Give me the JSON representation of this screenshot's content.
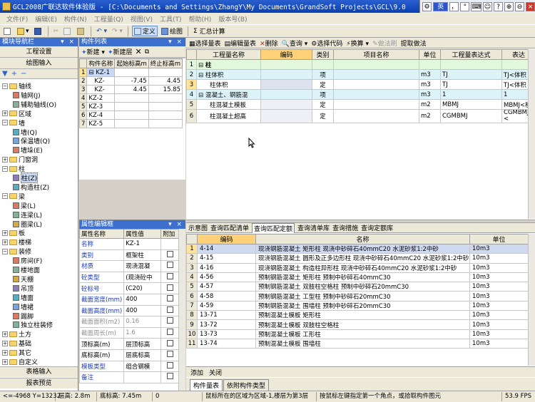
{
  "window": {
    "title": "GCL2008广联达软件体验版 - [C:\\Documents and Settings\\ZhangY\\My Documents\\GrandSoft Projects\\GCL\\9.0",
    "ime": {
      "lang": "英",
      "items": [
        "，",
        "°",
        "⌨",
        "☺",
        "?",
        "⊕",
        "⊖",
        "×"
      ]
    }
  },
  "menubar": [
    "文件(F)",
    "编辑(E)",
    "构件(N)",
    "工程量(Q)",
    "视图(V)",
    "工具(T)",
    "帮助(H)",
    "版本号(B)"
  ],
  "toolbar": {
    "define": "定义",
    "draw": "绘图",
    "sum": "汇总计算"
  },
  "nav": {
    "header": "模块导航栏",
    "project_settings": "工程设置",
    "drawing_input": "绘图输入",
    "tree": [
      {
        "label": "轴线",
        "pm": "⊟",
        "level": 0,
        "type": "folder"
      },
      {
        "label": "轴网(J)",
        "level": 1,
        "type": "item"
      },
      {
        "label": "辅助轴线(O)",
        "level": 1,
        "type": "item"
      },
      {
        "label": "区域",
        "pm": "⊞",
        "level": 0,
        "type": "folder"
      },
      {
        "label": "墙",
        "pm": "⊟",
        "level": 0,
        "type": "folder"
      },
      {
        "label": "墙(Q)",
        "level": 1,
        "type": "item"
      },
      {
        "label": "保温墙(Q)",
        "level": 1,
        "type": "item"
      },
      {
        "label": "墙垛(E)",
        "level": 1,
        "type": "item"
      },
      {
        "label": "门窗洞",
        "pm": "⊞",
        "level": 0,
        "type": "folder"
      },
      {
        "label": "柱",
        "pm": "⊟",
        "level": 0,
        "type": "folder"
      },
      {
        "label": "柱(Z)",
        "level": 1,
        "type": "item",
        "selected": true
      },
      {
        "label": "构造柱(Z)",
        "level": 1,
        "type": "item"
      },
      {
        "label": "梁",
        "pm": "⊟",
        "level": 0,
        "type": "folder"
      },
      {
        "label": "梁(L)",
        "level": 1,
        "type": "item"
      },
      {
        "label": "连梁(L)",
        "level": 1,
        "type": "item"
      },
      {
        "label": "圈梁(L)",
        "level": 1,
        "type": "item"
      },
      {
        "label": "板",
        "pm": "⊞",
        "level": 0,
        "type": "folder"
      },
      {
        "label": "楼梯",
        "pm": "⊞",
        "level": 0,
        "type": "folder"
      },
      {
        "label": "装修",
        "pm": "⊟",
        "level": 0,
        "type": "folder"
      },
      {
        "label": "房间(F)",
        "level": 1,
        "type": "item"
      },
      {
        "label": "楼地面",
        "level": 1,
        "type": "item"
      },
      {
        "label": "天棚",
        "level": 1,
        "type": "item"
      },
      {
        "label": "吊顶",
        "level": 1,
        "type": "item"
      },
      {
        "label": "墙面",
        "level": 1,
        "type": "item"
      },
      {
        "label": "墙裙",
        "level": 1,
        "type": "item"
      },
      {
        "label": "踢脚",
        "level": 1,
        "type": "item"
      },
      {
        "label": "独立柱装修",
        "level": 1,
        "type": "item"
      },
      {
        "label": "土方",
        "pm": "⊞",
        "level": 0,
        "type": "folder"
      },
      {
        "label": "基础",
        "pm": "⊞",
        "level": 0,
        "type": "folder"
      },
      {
        "label": "其它",
        "pm": "⊞",
        "level": 0,
        "type": "folder"
      },
      {
        "label": "自定义",
        "pm": "⊞",
        "level": 0,
        "type": "folder"
      }
    ],
    "table_input": "表格输入",
    "report_preview": "报表预览"
  },
  "component_list": {
    "header": "构件列表",
    "new": "新建",
    "new_layer": "新建层",
    "columns": [
      "构件名称",
      "起始标高m",
      "终止标高m"
    ],
    "rows": [
      {
        "n": "1",
        "name": "KZ-1",
        "prefix": "⊟",
        "start": "",
        "end": ""
      },
      {
        "n": "2",
        "name": "KZ-",
        "start": "-7.45",
        "end": "4.45"
      },
      {
        "n": "3",
        "name": "KZ-",
        "start": "4.45",
        "end": "15.85"
      },
      {
        "n": "4",
        "name": "KZ-2",
        "start": "",
        "end": ""
      },
      {
        "n": "5",
        "name": "KZ-3",
        "start": "",
        "end": ""
      },
      {
        "n": "6",
        "name": "KZ-4",
        "start": "",
        "end": ""
      },
      {
        "n": "7",
        "name": "KZ-5",
        "start": "",
        "end": ""
      }
    ]
  },
  "properties": {
    "header": "属性编辑框",
    "columns": [
      "属性名称",
      "属性值",
      "附加"
    ],
    "rows": [
      {
        "name": "名称",
        "value": "KZ-1",
        "style": "blue",
        "check": false
      },
      {
        "name": "类别",
        "value": "框架柱",
        "style": "blue",
        "check": true
      },
      {
        "name": "材质",
        "value": "现浇混凝",
        "style": "blue",
        "check": true
      },
      {
        "name": "砼类型",
        "value": "(现浇砼中",
        "style": "blue",
        "check": true
      },
      {
        "name": "砼标号",
        "value": "(C20)",
        "style": "blue",
        "check": true
      },
      {
        "name": "截面宽度(mm)",
        "value": "400",
        "style": "blue",
        "check": true
      },
      {
        "name": "截面高度(mm)",
        "value": "400",
        "style": "blue",
        "check": true
      },
      {
        "name": "截面面积(m2)",
        "value": "0.16",
        "style": "gray",
        "check": true
      },
      {
        "name": "截面周长(m)",
        "value": "1.6",
        "style": "gray",
        "check": true
      },
      {
        "name": "顶标高(m)",
        "value": "层顶标高",
        "style": "normal",
        "check": true
      },
      {
        "name": "底标高(m)",
        "value": "层底标高",
        "style": "normal",
        "check": true
      },
      {
        "name": "模板类型",
        "value": "组合钢模",
        "style": "blue",
        "check": true
      },
      {
        "name": "备注",
        "value": "",
        "style": "blue",
        "check": true
      }
    ]
  },
  "quantity_toolbar": {
    "select_qty": "选择量表",
    "edit_qty": "编辑量表",
    "delete": "删除",
    "query": "查询",
    "select_code": "选择代码",
    "convert": "换算",
    "brush": "做法刷",
    "extract": "提取做法"
  },
  "quantity_table": {
    "columns": [
      "工程量名称",
      "编码",
      "类别",
      "项目名称",
      "单位",
      "工程量表达式",
      "表达"
    ],
    "rows": [
      {
        "n": "1",
        "name": "柱",
        "code": "",
        "cat": "",
        "item": "",
        "unit": "",
        "expr": "",
        "more": "",
        "kind": "cat",
        "pm": "⊟"
      },
      {
        "n": "2",
        "name": "柱体积",
        "code": "",
        "cat": "项",
        "item": "",
        "unit": "m3",
        "expr": "TJ",
        "more": "TJ<体积",
        "kind": "hl",
        "pm": "⊟"
      },
      {
        "n": "3",
        "name": "柱体积",
        "code": "",
        "cat": "定",
        "item": "",
        "unit": "m3",
        "expr": "TJ",
        "more": "TJ<体积",
        "kind": "sel",
        "pm": ""
      },
      {
        "n": "4",
        "name": "混凝土、钢筋混",
        "code": "",
        "cat": "项",
        "item": "",
        "unit": "m3",
        "expr": "1",
        "more": "1",
        "kind": "hl",
        "pm": "⊟"
      },
      {
        "n": "5",
        "name": "柱混凝土模板",
        "code": "",
        "cat": "定",
        "item": "",
        "unit": "m2",
        "expr": "MBMJ",
        "more": "MBMJ<模",
        "kind": "normal",
        "pm": ""
      },
      {
        "n": "6",
        "name": "柱混凝土超高",
        "code": "",
        "cat": "定",
        "item": "",
        "unit": "m2",
        "expr": "CGMBMJ",
        "more": "CGMBMJ<",
        "kind": "normal",
        "pm": ""
      }
    ]
  },
  "bottom_tabs": [
    "示意图",
    "查询匹配清单",
    "查询匹配定额",
    "查询清单库",
    "查询措施",
    "查询定额库"
  ],
  "bottom_tabs_active": 2,
  "quota_table": {
    "columns": [
      "编码",
      "名称",
      "单位"
    ],
    "rows": [
      {
        "n": "1",
        "code": "4-14",
        "name": "现浇钢筋混凝土 矩形柱 现浇中砂碎石40mmC20 水泥砂浆1:2中砂",
        "unit": "10m3"
      },
      {
        "n": "2",
        "code": "4-15",
        "name": "现浇钢筋混凝土 圆形及正多边形柱 现浇中砂碎石40mmC20 水泥砂浆1:2中砂",
        "unit": "10m3"
      },
      {
        "n": "3",
        "code": "4-16",
        "name": "现浇钢筋混凝土 构造柱异形柱 现浇中砂碎石40mmC20 水泥砂浆1:2中砂",
        "unit": "10m3"
      },
      {
        "n": "4",
        "code": "4-56",
        "name": "预制钢筋混凝土 矩形柱 预制中砂碎石40mmC30",
        "unit": "10m3"
      },
      {
        "n": "5",
        "code": "4-57",
        "name": "预制钢筋混凝土 双肢柱空格柱 预制中砂碎石20mmC30",
        "unit": "10m3"
      },
      {
        "n": "6",
        "code": "4-58",
        "name": "预制钢筋混凝土 工型柱 预制中砂碎石20mmC30",
        "unit": "10m3"
      },
      {
        "n": "7",
        "code": "4-59",
        "name": "预制钢筋混凝土 围墙柱 预制中砂碎石20mmC30",
        "unit": "10m3"
      },
      {
        "n": "8",
        "code": "13-71",
        "name": "预制混凝土模板 矩形柱",
        "unit": "10m3"
      },
      {
        "n": "9",
        "code": "13-72",
        "name": "预制混凝土模板 双肢柱空格柱",
        "unit": "10m3"
      },
      {
        "n": "10",
        "code": "13-73",
        "name": "预制混凝土模板 工形柱",
        "unit": "10m3"
      },
      {
        "n": "11",
        "code": "13-74",
        "name": "预制混凝土模板 围墙柱",
        "unit": "10m3"
      }
    ]
  },
  "add_bar": {
    "add": "添加",
    "close": "关闭"
  },
  "sheet_tabs": [
    "构件量表",
    "依附构件类型"
  ],
  "status": {
    "coords": "<=-4968 Y=13232",
    "floor_height": "层高: 2.8m",
    "base_elev": "底标高: 7.45m",
    "zero": "0",
    "message1": "鼠标所在的区域为区域-1,楼层为第3层",
    "message2": "按鼠标左键指定第一个角点，或拾取构件图元",
    "fps": "53.9 FPS"
  }
}
